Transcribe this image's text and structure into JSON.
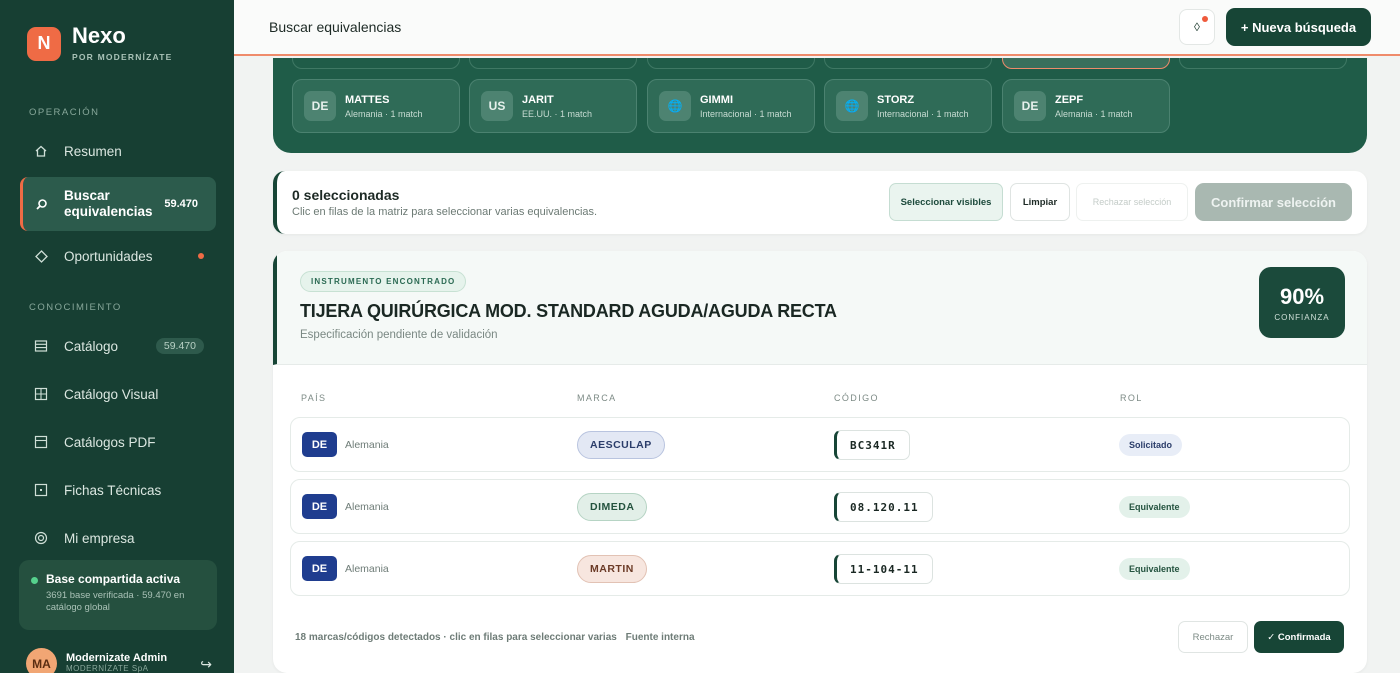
{
  "brand": {
    "logo_letter": "N",
    "name": "Nexo",
    "subtitle": "POR MODERNÍZATE",
    "accent": "#ef6b45"
  },
  "sidebar": {
    "section_operation": "OPERACIÓN",
    "section_knowledge": "CONOCIMIENTO",
    "items": [
      {
        "label": "Resumen",
        "icon": "home-icon"
      },
      {
        "label": "Buscar equivalencias",
        "icon": "search-icon",
        "count": "59.470",
        "active": true
      },
      {
        "label": "Oportunidades",
        "icon": "diamond-icon",
        "has_dot": true
      },
      {
        "label": "Catálogo",
        "icon": "catalog-icon",
        "count": "59.470"
      },
      {
        "label": "Catálogo Visual",
        "icon": "grid-icon"
      },
      {
        "label": "Catálogos PDF",
        "icon": "pdf-icon"
      },
      {
        "label": "Fichas Técnicas",
        "icon": "sheet-icon"
      },
      {
        "label": "Mi empresa",
        "icon": "company-icon"
      }
    ],
    "shared": {
      "title": "Base compartida activa",
      "desc": "3691 base verificada · 59.470 en catálogo global"
    },
    "user": {
      "initials": "MA",
      "name": "Modernizate Admin",
      "company": "MODERNÍZATE SpA"
    }
  },
  "topbar": {
    "title": "Buscar equivalencias",
    "new_search": "+ Nueva búsqueda"
  },
  "brand_cards": [
    {
      "code": "DE",
      "name": "MATTES",
      "meta": "Alemania · 1 match"
    },
    {
      "code": "US",
      "name": "JARIT",
      "meta": "EE.UU. · 1 match"
    },
    {
      "code": "🌐",
      "name": "GIMMI",
      "meta": "Internacional · 1 match"
    },
    {
      "code": "🌐",
      "name": "STORZ",
      "meta": "Internacional · 1 match"
    },
    {
      "code": "DE",
      "name": "ZEPF",
      "meta": "Alemania · 1 match"
    }
  ],
  "selection": {
    "title": "0 seleccionadas",
    "desc": "Clic en filas de la matriz para seleccionar varias equivalencias.",
    "btn_visible": "Seleccionar visibles",
    "btn_clear": "Limpiar",
    "btn_reject": "Rechazar selección",
    "btn_confirm": "Confirmar selección"
  },
  "instrument": {
    "badge": "INSTRUMENTO ENCONTRADO",
    "title": "TIJERA QUIRÚRGICA MOD. STANDARD AGUDA/AGUDA RECTA",
    "subtitle": "Especificación pendiente de validación",
    "confidence": "90%",
    "confidence_label": "CONFIANZA"
  },
  "table": {
    "headers": {
      "country": "PAÍS",
      "brand": "MARCA",
      "code": "CÓDIGO",
      "role": "ROL"
    },
    "rows": [
      {
        "country_code": "DE",
        "country": "Alemania",
        "brand": "AESCULAP",
        "code": "BC341R",
        "role": "Solicitado"
      },
      {
        "country_code": "DE",
        "country": "Alemania",
        "brand": "DIMEDA",
        "code": "08.120.11",
        "role": "Equivalente"
      },
      {
        "country_code": "DE",
        "country": "Alemania",
        "brand": "MARTIN",
        "code": "11-104-11",
        "role": "Equivalente"
      }
    ]
  },
  "footer": {
    "summary": "18 marcas/códigos detectados · clic en filas para seleccionar varias",
    "source": "Fuente interna",
    "reject": "Rechazar",
    "confirmed": "✓ Confirmada"
  }
}
